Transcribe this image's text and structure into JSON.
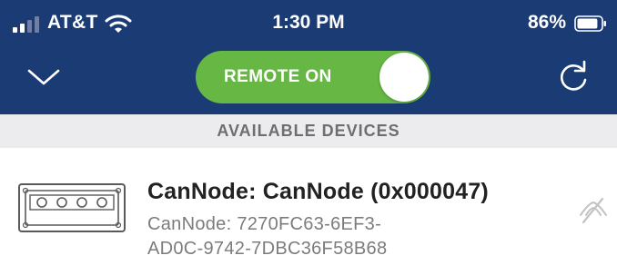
{
  "status_bar": {
    "carrier": "AT&T",
    "time": "1:30 PM",
    "battery_percent": "86%",
    "battery_level": 0.86,
    "signal_bars": 2,
    "signal_total": 4
  },
  "toolbar": {
    "remote_toggle_label": "REMOTE ON",
    "remote_toggle_state": true,
    "collapse_icon": "chevron-down-icon",
    "refresh_icon": "refresh-icon"
  },
  "section": {
    "title": "AVAILABLE DEVICES"
  },
  "devices": [
    {
      "name": "CanNode: CanNode (0x000047)",
      "id_line1": "CanNode: 7270FC63-6EF3-",
      "id_line2": "AD0C-9742-7DBC36F58B68",
      "icon": "device-module-icon",
      "status_icon": "no-signal-icon"
    }
  ],
  "colors": {
    "header_bg": "#1b3b74",
    "toggle_on": "#67b744",
    "section_bg": "#ececef",
    "section_text": "#6e6e70",
    "title_text": "#222222",
    "subtitle_text": "#7c7c7c"
  }
}
